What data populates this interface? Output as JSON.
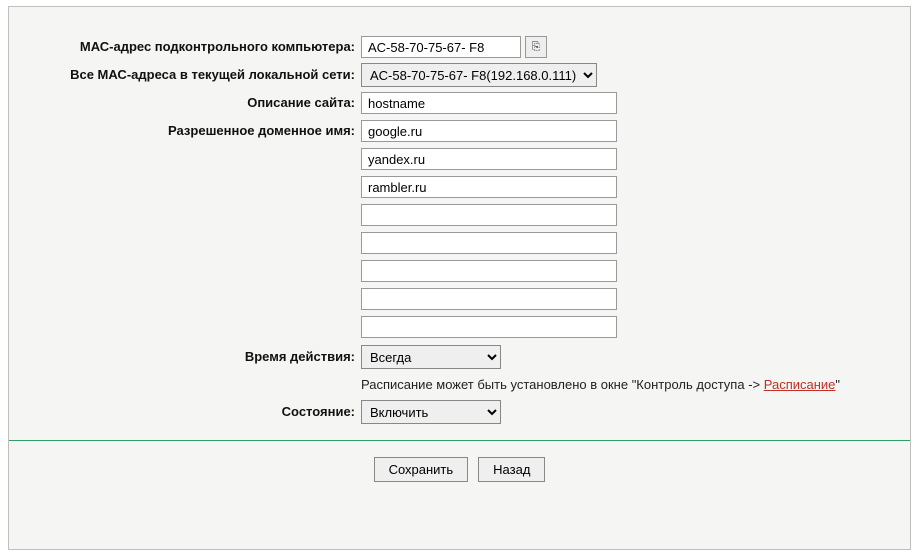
{
  "labels": {
    "mac_controlled": "МАС-адрес подконтрольного компьютера:",
    "mac_list": "Все МАС-адреса в текущей локальной сети:",
    "site_desc": "Описание сайта:",
    "allowed_domain": "Разрешенное доменное имя:",
    "time": "Время действия:",
    "state": "Состояние:"
  },
  "fields": {
    "mac_controlled_value": "AC-58-70-75-67- F8",
    "mac_list_selected": "AC-58-70-75-67- F8(192.168.0.111)",
    "site_desc_value": "hostname",
    "domains": [
      "google.ru",
      "yandex.ru",
      "rambler.ru",
      "",
      "",
      "",
      "",
      ""
    ],
    "time_selected": "Всегда",
    "state_selected": "Включить"
  },
  "note": {
    "prefix": "Расписание может быть установлено в окне \"Контроль доступа -> ",
    "link": "Расписание",
    "suffix": "\""
  },
  "buttons": {
    "save": "Сохранить",
    "back": "Назад"
  },
  "icons": {
    "copy": "⎘"
  }
}
